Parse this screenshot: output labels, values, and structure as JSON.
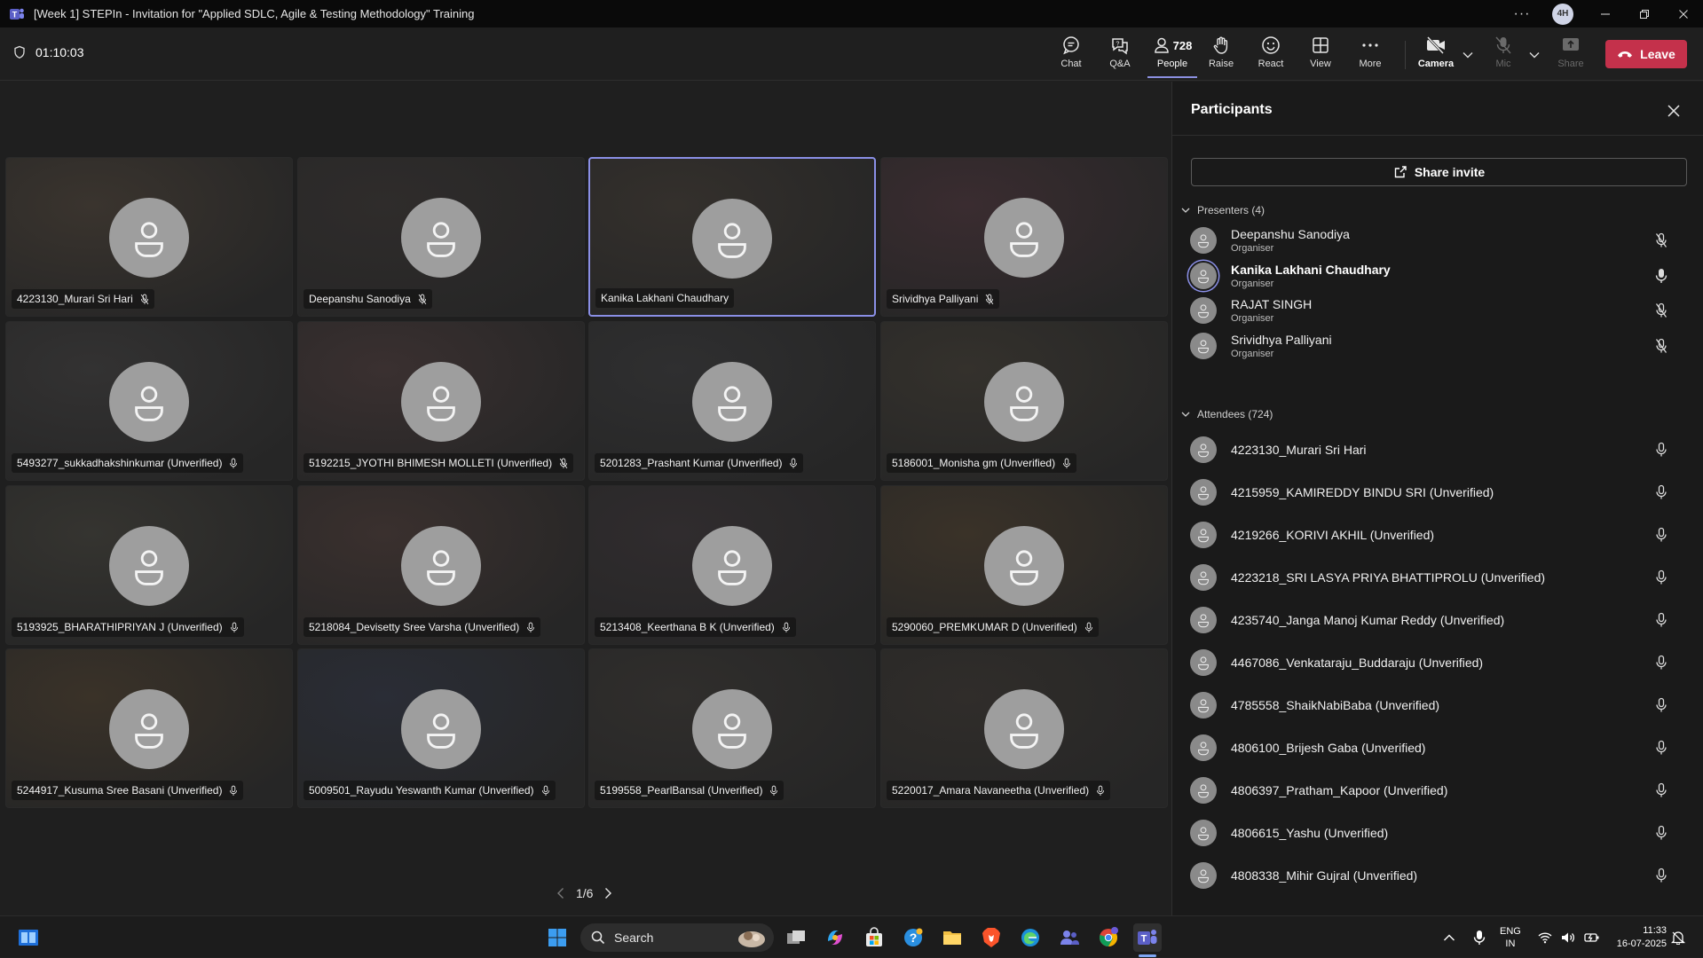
{
  "window": {
    "title": "[Week 1] STEPIn - Invitation for \"Applied SDLC, Agile & Testing Methodology\" Training",
    "avatar_initials": "4H"
  },
  "toolbar": {
    "timer": "01:10:03",
    "chat": "Chat",
    "qa": "Q&A",
    "people": "People",
    "people_count": "728",
    "raise": "Raise",
    "react": "React",
    "view": "View",
    "more": "More",
    "camera": "Camera",
    "mic": "Mic",
    "share": "Share",
    "leave": "Leave"
  },
  "tiles": [
    {
      "name": "4223130_Murari Sri Hari",
      "mic": "muted",
      "bg": "#3a342e"
    },
    {
      "name": "Deepanshu Sanodiya",
      "mic": "muted",
      "bg": "#2f2c2b"
    },
    {
      "name": "Kanika Lakhani Chaudhary",
      "mic": "none",
      "bg": "#34302c",
      "active": true
    },
    {
      "name": "Srividhya Palliyani",
      "mic": "muted",
      "bg": "#3a2c30"
    },
    {
      "name": "5493277_sukkadhakshinkumar (Unverified)",
      "mic": "on",
      "bg": "#333232"
    },
    {
      "name": "5192215_JYOTHI BHIMESH MOLLETI (Unverified)",
      "mic": "muted",
      "bg": "#3a3030"
    },
    {
      "name": "5201283_Prashant Kumar (Unverified)",
      "mic": "on",
      "bg": "#2f2f30"
    },
    {
      "name": "5186001_Monisha gm (Unverified)",
      "mic": "on",
      "bg": "#34312c"
    },
    {
      "name": "5193925_BHARATHIPRIYAN J (Unverified)",
      "mic": "on",
      "bg": "#353430"
    },
    {
      "name": "5218084_Devisetty Sree Varsha (Unverified)",
      "mic": "on",
      "bg": "#3a302e"
    },
    {
      "name": "5213408_Keerthana B K (Unverified)",
      "mic": "on",
      "bg": "#302c2e"
    },
    {
      "name": "5290060_PREMKUMAR D (Unverified)",
      "mic": "on",
      "bg": "#3a3228"
    },
    {
      "name": "5244917_Kusuma Sree Basani (Unverified)",
      "mic": "on",
      "bg": "#3a3228"
    },
    {
      "name": "5009501_Rayudu Yeswanth Kumar (Unverified)",
      "mic": "on",
      "bg": "#2a2d36"
    },
    {
      "name": "5199558_PearlBansal (Unverified)",
      "mic": "on",
      "bg": "#302e2c"
    },
    {
      "name": "5220017_Amara Navaneetha (Unverified)",
      "mic": "on",
      "bg": "#302d2a"
    }
  ],
  "pager": {
    "label": "1/6"
  },
  "panel": {
    "title": "Participants",
    "share_invite": "Share invite",
    "presenters_label": "Presenters (4)",
    "attendees_label": "Attendees (724)",
    "presenters": [
      {
        "name": "Deepanshu Sanodiya",
        "role": "Organiser",
        "mic": "muted",
        "speaking": false
      },
      {
        "name": "Kanika Lakhani Chaudhary",
        "role": "Organiser",
        "mic": "on",
        "speaking": true
      },
      {
        "name": "RAJAT SINGH",
        "role": "Organiser",
        "mic": "muted",
        "speaking": false
      },
      {
        "name": "Srividhya Palliyani",
        "role": "Organiser",
        "mic": "muted",
        "speaking": false
      }
    ],
    "attendees": [
      {
        "name": "4223130_Murari Sri Hari"
      },
      {
        "name": "4215959_KAMIREDDY BINDU SRI (Unverified)"
      },
      {
        "name": "4219266_KORIVI AKHIL (Unverified)"
      },
      {
        "name": "4223218_SRI LASYA PRIYA BHATTIPROLU (Unverified)"
      },
      {
        "name": "4235740_Janga Manoj Kumar Reddy (Unverified)"
      },
      {
        "name": "4467086_Venkataraju_Buddaraju (Unverified)"
      },
      {
        "name": "4785558_ShaikNabiBaba (Unverified)"
      },
      {
        "name": "4806100_Brijesh Gaba (Unverified)"
      },
      {
        "name": "4806397_Pratham_Kapoor (Unverified)"
      },
      {
        "name": "4806615_Yashu (Unverified)"
      },
      {
        "name": "4808338_Mihir Gujral (Unverified)"
      }
    ]
  },
  "taskbar": {
    "search_placeholder": "Search",
    "lang_line1": "ENG",
    "lang_line2": "IN",
    "time": "11:33",
    "date": "16-07-2025"
  },
  "colors": {
    "accent": "#8a8fe6",
    "leave": "#c4314b",
    "brand": "#5b5fc7"
  }
}
